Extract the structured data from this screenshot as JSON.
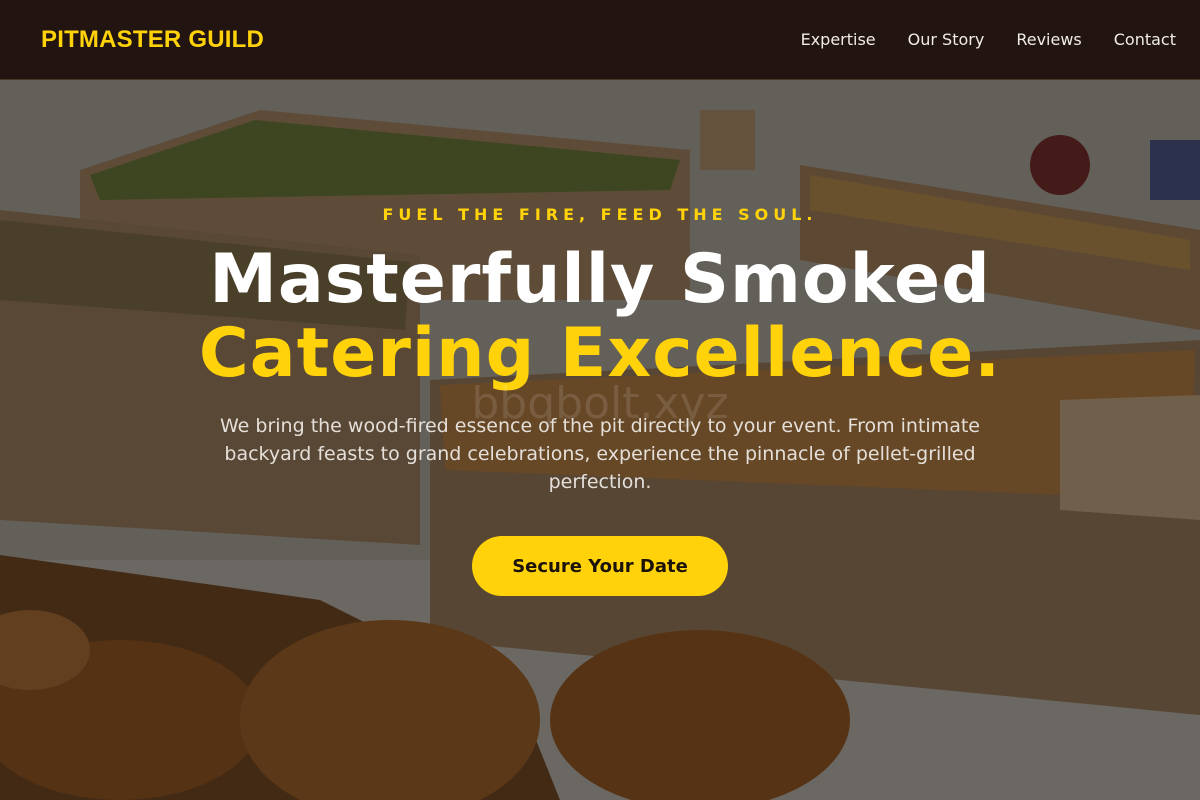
{
  "header": {
    "brand": "PITMASTER GUILD",
    "nav": [
      {
        "label": "Expertise"
      },
      {
        "label": "Our Story"
      },
      {
        "label": "Reviews"
      },
      {
        "label": "Contact"
      }
    ]
  },
  "hero": {
    "tagline": "FUEL THE FIRE, FEED THE SOUL.",
    "headline_line1": "Masterfully Smoked",
    "headline_line2": "Catering Excellence.",
    "watermark": "bbqbolt.xyz",
    "description": "We bring the wood-fired essence of the pit directly to your event. From intimate backyard feasts to grand celebrations, experience the pinnacle of pellet-grilled perfection.",
    "cta_label": "Secure Your Date",
    "background_image": "catering-food-boxes-photo"
  },
  "colors": {
    "accent": "#ffd20a",
    "header_bg": "#1c0e0c",
    "headline_white": "#ffffff",
    "body_text": "#e4dfd9",
    "cta_text": "#1b130a"
  }
}
